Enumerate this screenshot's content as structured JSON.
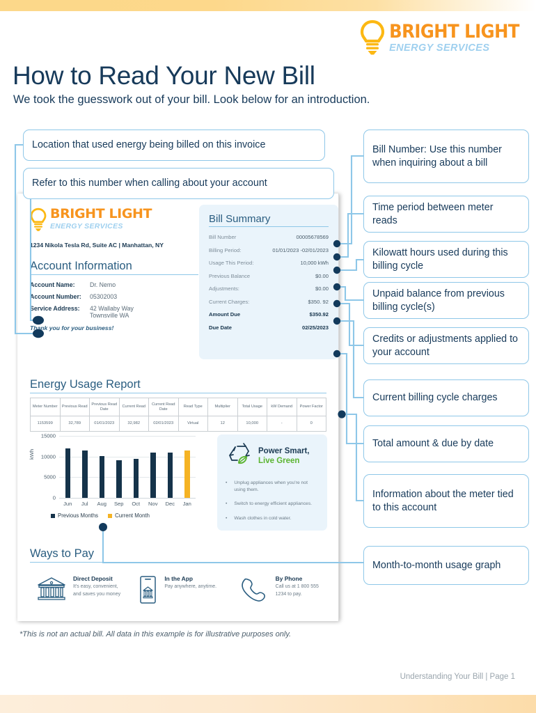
{
  "header": {
    "brand_name": "BRIGHT LIGHT",
    "brand_sub": "ENERGY SERVICES",
    "title": "How to Read Your New Bill",
    "subtitle": "We took the guesswork out of your bill. Look below for an introduction."
  },
  "callouts": {
    "left": [
      "Location that used energy being billed on this invoice",
      "Refer to this number when calling about your account"
    ],
    "right": [
      "Bill Number: Use this number when inquiring about a bill",
      "Time period between meter reads",
      "Kilowatt hours used during this billing cycle",
      "Unpaid balance from previous billing cycle(s)",
      "Credits or adjustments applied to your account",
      "Current billing cycle charges",
      "Total amount & due by date",
      "Information about the meter tied to this account",
      "Month-to-month usage graph"
    ]
  },
  "bill": {
    "brand_name": "BRIGHT LIGHT",
    "brand_sub": "ENERGY SERVICES",
    "company_address": "1234 Nikola Tesla Rd, Suite AC | Manhattan, NY",
    "account_section_title": "Account Information",
    "account": [
      {
        "label": "Account Name:",
        "value": "Dr. Nemo"
      },
      {
        "label": "Account Number:",
        "value": "05302003"
      },
      {
        "label": "Service Address:",
        "value": "42 Wallaby Way\nTownsville WA"
      }
    ],
    "thanks": "Thank you for your business!",
    "summary_title": "Bill Summary",
    "summary": [
      {
        "label": "Bill Number",
        "value": "00005678569",
        "bold": false
      },
      {
        "label": "Billing Period:",
        "value": "01/01/2023 -02/01/2023",
        "bold": false
      },
      {
        "label": "Usage This Period:",
        "value": "10,000 kWh",
        "bold": false
      },
      {
        "label": "Previous Balance",
        "value": "$0.00",
        "bold": false
      },
      {
        "label": "Adjustments:",
        "value": "$0.00",
        "bold": false
      },
      {
        "label": "Current Charges:",
        "value": "$350. 92",
        "bold": false
      },
      {
        "label": "Amount Due",
        "value": "$350.92",
        "bold": true
      },
      {
        "label": "Due Date",
        "value": "02/25/2023",
        "bold": true
      }
    ],
    "usage_title": "Energy Usage Report",
    "meter_headers": [
      "Meter Number",
      "Previous Read",
      "Previous Read Date",
      "Current Read",
      "Current Read Date",
      "Read Type",
      "Multiplier",
      "Total Usage",
      "kW Demand",
      "Power Factor"
    ],
    "meter_row": [
      "1153599",
      "32,789",
      "01/01/2023",
      "32,982",
      "02/01/2023",
      "Virtual",
      "12",
      "10,000",
      "-",
      "0"
    ],
    "power_smart": {
      "title_1": "Power Smart,",
      "title_2": "Live Green",
      "tips": [
        "Unplug appliances when you're not using them.",
        "Switch to energy efficient appliances.",
        "Wash clothes in cold water."
      ]
    },
    "pay_title": "Ways to Pay",
    "pay_methods": [
      {
        "icon": "bank-icon",
        "title": "Direct Deposit",
        "desc": "It's easy, convenient, and saves you money"
      },
      {
        "icon": "phone-app-icon",
        "title": "In the App",
        "desc": "Pay anywhere, anytime."
      },
      {
        "icon": "telephone-icon",
        "title": "By Phone",
        "desc": "Call us at 1 800 555 1234 to pay."
      }
    ]
  },
  "footer": {
    "disclaimer": "*This is not an actual bill. All data in this example is for illustrative purposes only.",
    "page_label": "Understanding Your Bill | Page 1"
  },
  "colors": {
    "brand_orange": "#f7941e",
    "brand_light_blue": "#9fd0ef",
    "callout_border": "#8ec7e8",
    "dark_navy": "#15334a",
    "current_month": "#f5b324",
    "green": "#5bb431"
  },
  "chart_data": {
    "type": "bar",
    "title": "",
    "xlabel": "",
    "ylabel": "kWh",
    "categories": [
      "Jun",
      "Jul",
      "Aug",
      "Sep",
      "Oct",
      "Nov",
      "Dec",
      "Jan"
    ],
    "values": [
      12000,
      11500,
      10100,
      9100,
      9500,
      11000,
      11000,
      11500
    ],
    "series": [
      {
        "name": "Previous Months",
        "color": "#15334a",
        "values": [
          12000,
          11500,
          10100,
          9100,
          9500,
          11000,
          11000,
          null
        ]
      },
      {
        "name": "Current Month",
        "color": "#f5b324",
        "values": [
          null,
          null,
          null,
          null,
          null,
          null,
          null,
          11500
        ]
      }
    ],
    "ylim": [
      0,
      15000
    ],
    "yticks": [
      0,
      5000,
      10000,
      15000
    ],
    "grid": true,
    "legend": [
      "Previous Months",
      "Current Month"
    ],
    "legend_position": "bottom"
  }
}
